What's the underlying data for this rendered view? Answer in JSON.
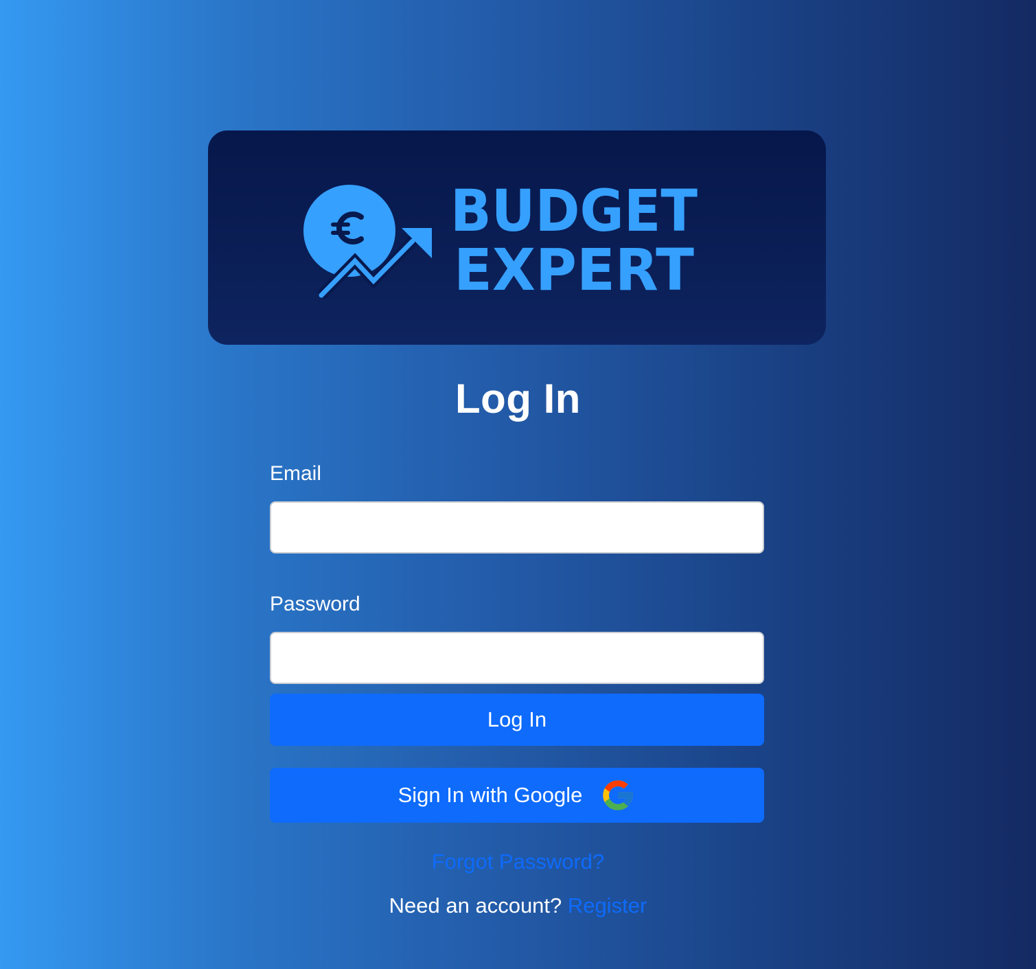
{
  "logo": {
    "line1": "BUDGET",
    "line2": "EXPERT",
    "icon": "euro-coin-trend-arrow-icon",
    "color": "#36a0ff",
    "background": "#08194d"
  },
  "page": {
    "title": "Log In"
  },
  "form": {
    "email_label": "Email",
    "email_value": "",
    "password_label": "Password",
    "password_value": "",
    "login_button": "Log In",
    "google_button": "Sign In with Google",
    "google_icon": "google-g-icon"
  },
  "links": {
    "forgot_password": "Forgot Password?",
    "need_account": "Need an account?",
    "register": "Register"
  },
  "colors": {
    "primary_button": "#0e6bfb",
    "link": "#0e6bfb",
    "gradient_start": "#3599f1",
    "gradient_end": "#142a63"
  }
}
